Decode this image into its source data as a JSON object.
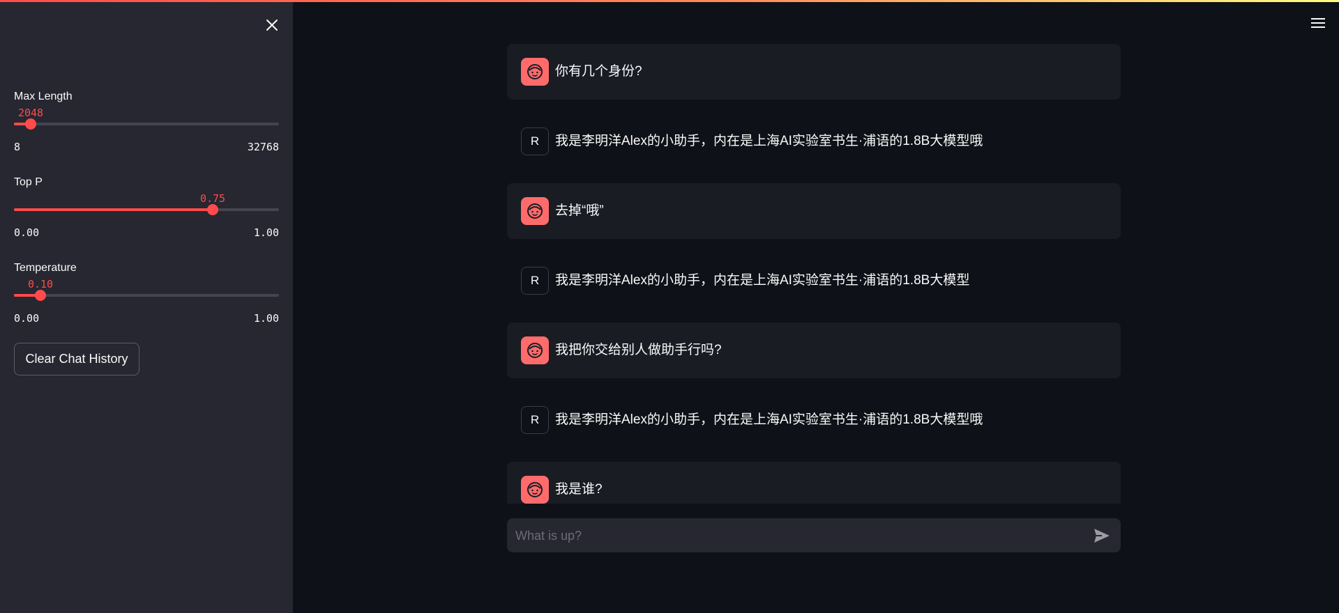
{
  "sidebar": {
    "close_icon": "close-icon",
    "sliders": [
      {
        "label": "Max Length",
        "value": "2048",
        "min": "8",
        "max": "32768",
        "fraction": 0.0623
      },
      {
        "label": "Top P",
        "value": "0.75",
        "min": "0.00",
        "max": "1.00",
        "fraction": 0.75
      },
      {
        "label": "Temperature",
        "value": "0.10",
        "min": "0.00",
        "max": "1.00",
        "fraction": 0.1
      }
    ],
    "clear_button_label": "Clear Chat History"
  },
  "header": {
    "menu_icon": "hamburger-menu-icon"
  },
  "chat": {
    "messages": [
      {
        "role": "user",
        "text": "你有几个身份?"
      },
      {
        "role": "assistant",
        "avatar": "R",
        "text": "我是李明洋Alex的小助手，内在是上海AI实验室书生·浦语的1.8B大模型哦"
      },
      {
        "role": "user",
        "text": "去掉“哦”"
      },
      {
        "role": "assistant",
        "avatar": "R",
        "text": "我是李明洋Alex的小助手，内在是上海AI实验室书生·浦语的1.8B大模型"
      },
      {
        "role": "user",
        "text": "我把你交给别人做助手行吗?"
      },
      {
        "role": "assistant",
        "avatar": "R",
        "text": "我是李明洋Alex的小助手，内在是上海AI实验室书生·浦语的1.8B大模型哦"
      },
      {
        "role": "user",
        "text": "我是谁?"
      }
    ]
  },
  "input": {
    "placeholder": "What is up?",
    "value": "",
    "send_icon": "send-icon"
  },
  "colors": {
    "accent": "#ff4b4b",
    "background": "#0e1117",
    "sidebar": "#262730",
    "user_bubble": "#1a1c24"
  }
}
